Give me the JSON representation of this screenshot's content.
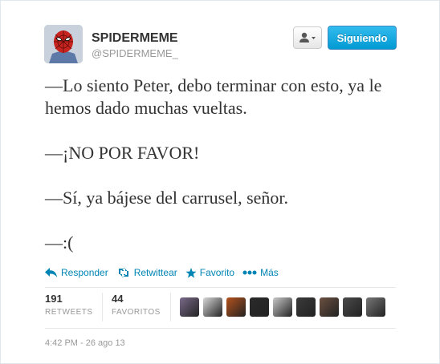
{
  "header": {
    "name": "SPIDERMEME",
    "handle": "@SPIDERMEME_",
    "follow_label": "Siguiendo",
    "user_menu_icon": "person-dropdown-icon"
  },
  "tweet": {
    "lines": [
      "—Lo siento Peter, debo terminar con esto, ya le hemos dado muchas vueltas.",
      "—¡NO POR FAVOR!",
      "—Sí, ya bájese del carrusel, señor.",
      "—:("
    ]
  },
  "actions": {
    "reply": "Responder",
    "retweet": "Retwittear",
    "favorite": "Favorito",
    "more": "Más"
  },
  "stats": {
    "retweets_count": "191",
    "retweets_label": "RETWEETS",
    "favorites_count": "44",
    "favorites_label": "FAVORITOS"
  },
  "favoriters": [
    {
      "color": "#7a6a8a"
    },
    {
      "color": "#d8d8d8"
    },
    {
      "color": "#b5521c"
    },
    {
      "color": "#2a2a2a"
    },
    {
      "color": "#c9c9c9"
    },
    {
      "color": "#3a3a3a"
    },
    {
      "color": "#6b5040"
    },
    {
      "color": "#4a4a4a"
    },
    {
      "color": "#777777"
    }
  ],
  "timestamp": "4:42 PM - 26 ago 13",
  "colors": {
    "link": "#0084b4",
    "follow_button": "#019ad2"
  }
}
